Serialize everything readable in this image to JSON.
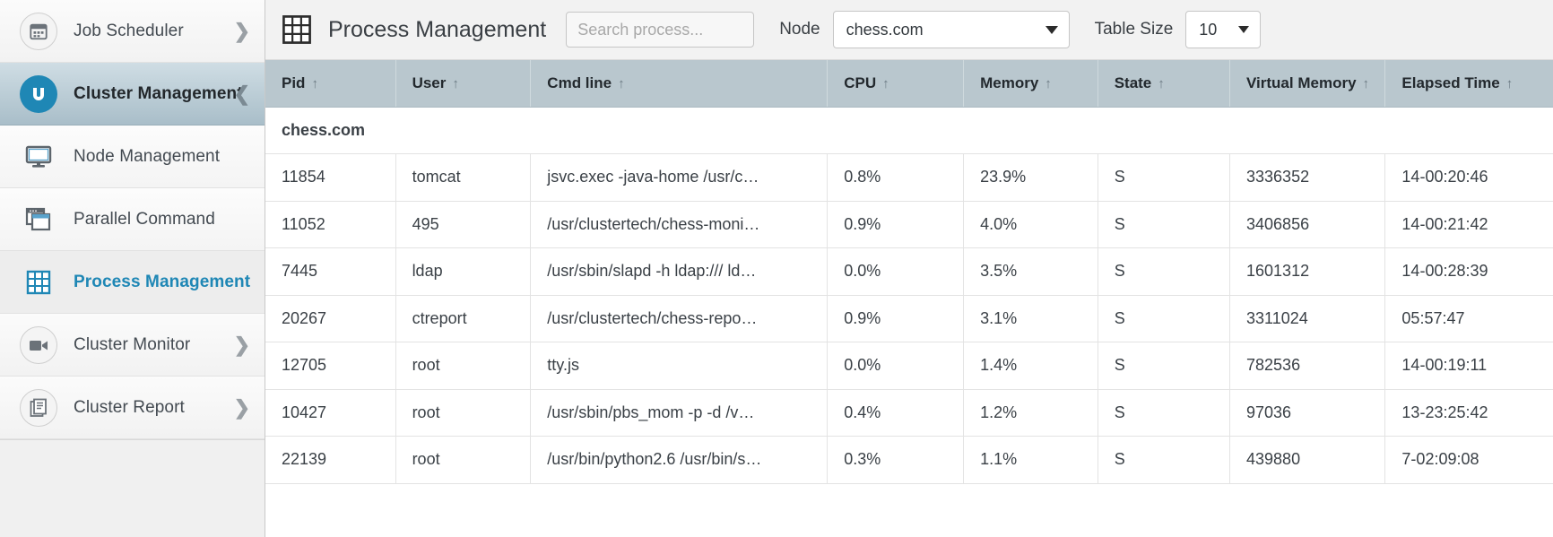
{
  "sidebar": {
    "items": [
      {
        "label": "Job Scheduler",
        "icon": "calendar-icon",
        "state": "collapsed",
        "chevron": "right"
      },
      {
        "label": "Cluster Management",
        "icon": "brand-u-icon",
        "state": "expanded",
        "chevron": "down"
      },
      {
        "label": "Node Management",
        "icon": "monitor-icon",
        "state": "child",
        "chevron": ""
      },
      {
        "label": "Parallel Command",
        "icon": "windows-icon",
        "state": "child",
        "chevron": ""
      },
      {
        "label": "Process Management",
        "icon": "grid-icon",
        "state": "current",
        "chevron": ""
      },
      {
        "label": "Cluster Monitor",
        "icon": "camera-icon",
        "state": "collapsed",
        "chevron": "right"
      },
      {
        "label": "Cluster Report",
        "icon": "document-icon",
        "state": "collapsed",
        "chevron": "right"
      }
    ]
  },
  "toolbar": {
    "page_icon": "grid-icon",
    "title": "Process Management",
    "search_value": "",
    "search_placeholder": "Search process...",
    "node_label": "Node",
    "node_value": "chess.com",
    "table_size_label": "Table Size",
    "table_size_value": "10",
    "dropdown_icon": "chevron-down-icon"
  },
  "table": {
    "columns": [
      {
        "key": "pid",
        "label": "Pid",
        "sort": "↑"
      },
      {
        "key": "user",
        "label": "User",
        "sort": "↑"
      },
      {
        "key": "cmd",
        "label": "Cmd line",
        "sort": "↑"
      },
      {
        "key": "cpu",
        "label": "CPU",
        "sort": "↑"
      },
      {
        "key": "mem",
        "label": "Memory",
        "sort": "↑"
      },
      {
        "key": "state",
        "label": "State",
        "sort": "↑"
      },
      {
        "key": "vmem",
        "label": "Virtual Memory",
        "sort": "↑"
      },
      {
        "key": "time",
        "label": "Elapsed Time",
        "sort": "↑"
      }
    ],
    "group_label": "chess.com",
    "rows": [
      {
        "pid": "11854",
        "user": "tomcat",
        "cmd": "jsvc.exec -java-home /usr/c…",
        "cpu": "0.8%",
        "mem": "23.9%",
        "state": "S",
        "vmem": "3336352",
        "time": "14-00:20:46"
      },
      {
        "pid": "11052",
        "user": "495",
        "cmd": "/usr/clustertech/chess-moni…",
        "cpu": "0.9%",
        "mem": "4.0%",
        "state": "S",
        "vmem": "3406856",
        "time": "14-00:21:42"
      },
      {
        "pid": "7445",
        "user": "ldap",
        "cmd": "/usr/sbin/slapd -h ldap:/// ld…",
        "cpu": "0.0%",
        "mem": "3.5%",
        "state": "S",
        "vmem": "1601312",
        "time": "14-00:28:39"
      },
      {
        "pid": "20267",
        "user": "ctreport",
        "cmd": "/usr/clustertech/chess-repo…",
        "cpu": "0.9%",
        "mem": "3.1%",
        "state": "S",
        "vmem": "3311024",
        "time": "05:57:47"
      },
      {
        "pid": "12705",
        "user": "root",
        "cmd": "tty.js",
        "cpu": "0.0%",
        "mem": "1.4%",
        "state": "S",
        "vmem": "782536",
        "time": "14-00:19:11"
      },
      {
        "pid": "10427",
        "user": "root",
        "cmd": "/usr/sbin/pbs_mom -p -d /v…",
        "cpu": "0.4%",
        "mem": "1.2%",
        "state": "S",
        "vmem": "97036",
        "time": "13-23:25:42"
      },
      {
        "pid": "22139",
        "user": "root",
        "cmd": "/usr/bin/python2.6 /usr/bin/s…",
        "cpu": "0.3%",
        "mem": "1.1%",
        "state": "S",
        "vmem": "439880",
        "time": "7-02:09:08"
      }
    ]
  },
  "colors": {
    "brand": "#1f87b5",
    "header_row": "#b9c7ce",
    "active_nav": "#a9bec9",
    "text": "#3a4046"
  }
}
